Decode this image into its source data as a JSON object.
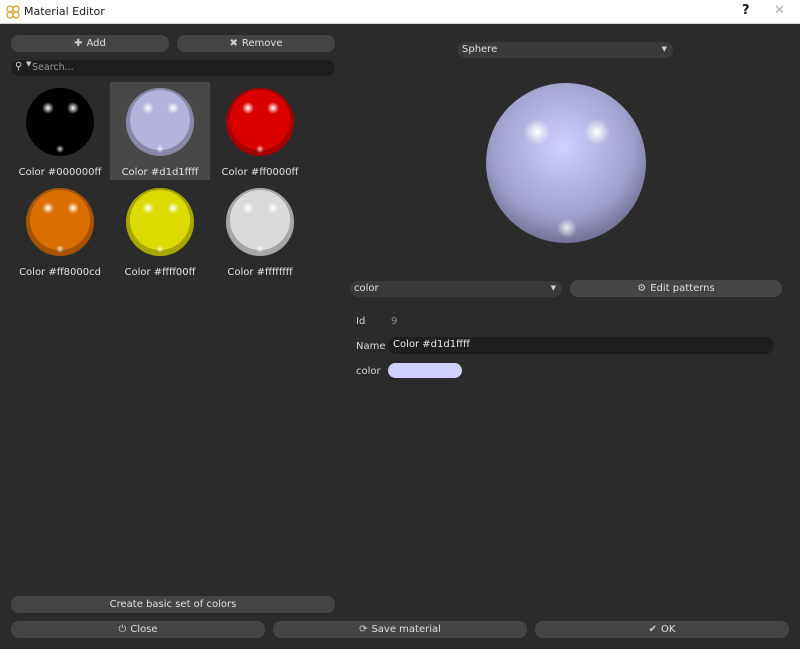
{
  "window": {
    "title": "Material Editor",
    "help": "?",
    "close": "✕"
  },
  "toolbar": {
    "add_label": "Add",
    "remove_label": "Remove"
  },
  "search": {
    "placeholder": "Search..."
  },
  "materials": [
    {
      "label": "Color #000000ff",
      "color": "#000000"
    },
    {
      "label": "Color #d1d1ffff",
      "color": "#d1d1ff"
    },
    {
      "label": "Color #ff0000ff",
      "color": "#ff0000"
    },
    {
      "label": "Color #ff8000cd",
      "color": "#ff8000"
    },
    {
      "label": "Color #ffff00ff",
      "color": "#ffff00"
    },
    {
      "label": "Color #ffffffff",
      "color": "#ffffff"
    }
  ],
  "selected_index": 1,
  "preview": {
    "shape": "Sphere",
    "color": "#d1d1ff"
  },
  "pattern": {
    "selected": "color",
    "edit_label": "Edit patterns"
  },
  "properties": {
    "id_label": "Id",
    "id_value": "9",
    "name_label": "Name",
    "name_value": "Color #d1d1ffff",
    "color_label": "color",
    "color_value": "#d1d1ff"
  },
  "footer": {
    "create_basic_label": "Create basic set of colors",
    "close_label": "Close",
    "save_label": "Save material",
    "ok_label": "OK"
  }
}
